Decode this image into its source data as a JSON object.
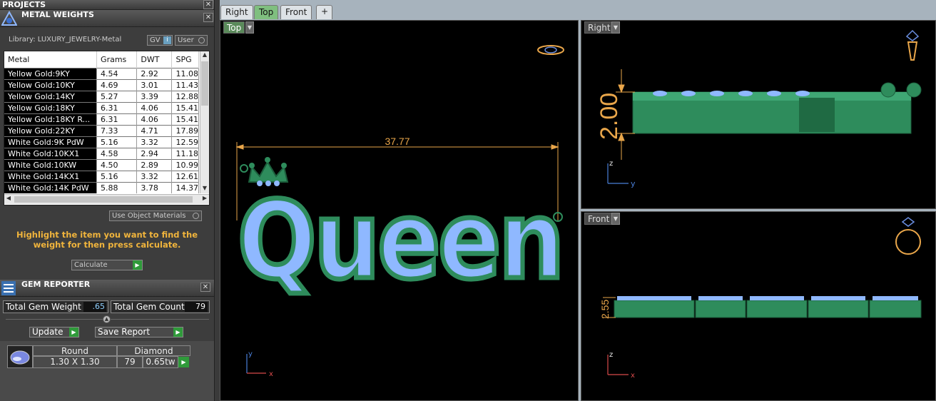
{
  "projects": {
    "title": "PROJECTS",
    "close": "✕"
  },
  "metal_weights": {
    "title": "METAL WEIGHTS",
    "library": "Library: LUXURY_JEWELRY-Metal",
    "gv_label": "GV",
    "user_label": "User",
    "columns": [
      "Metal",
      "Grams",
      "DWT",
      "SPG"
    ],
    "rows": [
      [
        "Yellow Gold:9KY",
        "4.54",
        "2.92",
        "11.08"
      ],
      [
        "Yellow Gold:10KY",
        "4.69",
        "3.01",
        "11.43"
      ],
      [
        "Yellow Gold:14KY",
        "5.27",
        "3.39",
        "12.88"
      ],
      [
        "Yellow Gold:18KY",
        "6.31",
        "4.06",
        "15.41"
      ],
      [
        "Yellow Gold:18KY R...",
        "6.31",
        "4.06",
        "15.41"
      ],
      [
        "Yellow Gold:22KY",
        "7.33",
        "4.71",
        "17.89"
      ],
      [
        "White Gold:9K PdW",
        "5.16",
        "3.32",
        "12.59"
      ],
      [
        "White Gold:10KX1",
        "4.58",
        "2.94",
        "11.18"
      ],
      [
        "White Gold:10KW",
        "4.50",
        "2.89",
        "10.99"
      ],
      [
        "White Gold:14KX1",
        "5.16",
        "3.32",
        "12.61"
      ],
      [
        "White Gold:14K PdW",
        "5.88",
        "3.78",
        "14.37"
      ]
    ],
    "use_object_materials": "Use Object Materials",
    "instructions": "Highlight the item you want to find the weight for then press calculate.",
    "calculate": "Calculate"
  },
  "gem_reporter": {
    "title": "GEM REPORTER",
    "total_weight_label": "Total Gem Weight",
    "total_weight_value": ".65",
    "total_count_label": "Total Gem Count",
    "total_count_value": "79",
    "update": "Update",
    "save_report": "Save Report",
    "gem": {
      "shape": "Round",
      "material": "Diamond",
      "size": "1.30 X 1.30",
      "count": "79",
      "weight": "0.65tw"
    }
  },
  "viewport": {
    "tabs": [
      "Right",
      "Top",
      "Front"
    ],
    "active_tab": "Top",
    "add_tab": "+",
    "views": {
      "top": {
        "label": "Top",
        "dimension": "37.77",
        "text": "Queen",
        "axis_v": "y",
        "axis_h": "x"
      },
      "right": {
        "label": "Right",
        "dimension": "2.00",
        "axis_v": "z",
        "axis_h": "y"
      },
      "front": {
        "label": "Front",
        "dimension": "2.55",
        "axis_v": "z",
        "axis_h": "x"
      }
    }
  },
  "colors": {
    "metal": "#2e8c5c",
    "gem": "#8fb8ff",
    "dimension": "#e9a64a",
    "accent_text": "#f0b43c"
  }
}
